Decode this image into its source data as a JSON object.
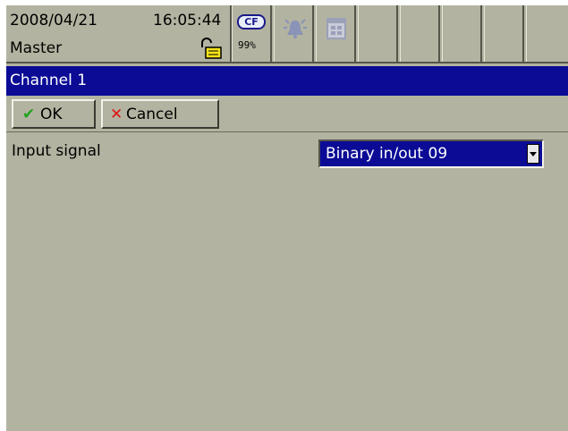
{
  "status": {
    "date": "2008/04/21",
    "time": "16:05:44",
    "user": "Master",
    "storage_label": "CF",
    "storage_usage": "99%"
  },
  "dialog": {
    "title": "Channel 1",
    "ok_label": "OK",
    "cancel_label": "Cancel"
  },
  "form": {
    "input_signal_label": "Input signal",
    "input_signal_value": "Binary in/out 09"
  },
  "colors": {
    "panel_bg": "#b3b3a1",
    "titlebar_bg": "#0b0b96",
    "ok_check": "#1fa11f",
    "cancel_x": "#e01010"
  }
}
